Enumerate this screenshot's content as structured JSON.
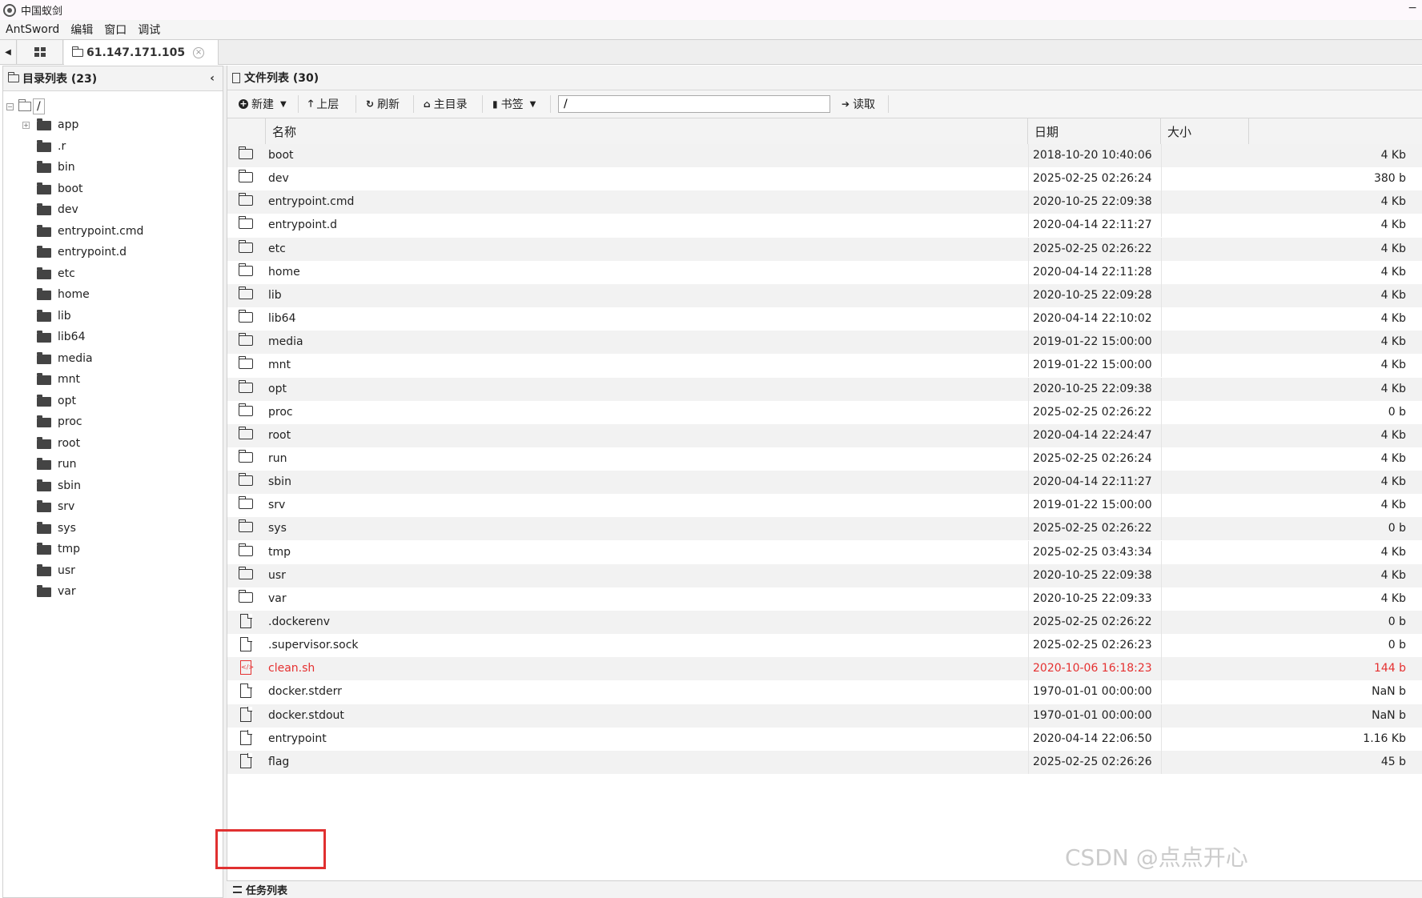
{
  "window": {
    "title": "中国蚁剑"
  },
  "menu": [
    "AntSword",
    "编辑",
    "窗口",
    "调试"
  ],
  "tabs": {
    "host": "61.147.171.105"
  },
  "left_panel": {
    "header": "目录列表 (23)",
    "root": "/",
    "items": [
      {
        "label": "app",
        "expandable": true
      },
      {
        "label": ".r"
      },
      {
        "label": "bin"
      },
      {
        "label": "boot"
      },
      {
        "label": "dev"
      },
      {
        "label": "entrypoint.cmd"
      },
      {
        "label": "entrypoint.d"
      },
      {
        "label": "etc"
      },
      {
        "label": "home"
      },
      {
        "label": "lib"
      },
      {
        "label": "lib64"
      },
      {
        "label": "media"
      },
      {
        "label": "mnt"
      },
      {
        "label": "opt"
      },
      {
        "label": "proc"
      },
      {
        "label": "root"
      },
      {
        "label": "run"
      },
      {
        "label": "sbin"
      },
      {
        "label": "srv"
      },
      {
        "label": "sys"
      },
      {
        "label": "tmp"
      },
      {
        "label": "usr"
      },
      {
        "label": "var"
      }
    ]
  },
  "right_panel": {
    "header": "文件列表 (30)",
    "toolbar": {
      "new_label": "新建",
      "up_label": "上层",
      "refresh_label": "刷新",
      "home_label": "主目录",
      "bookmark_label": "书签",
      "path_value": "/",
      "read_label": "读取"
    },
    "columns": {
      "name": "名称",
      "date": "日期",
      "size": "大小"
    },
    "files": [
      {
        "name": "boot",
        "date": "2018-10-20 10:40:06",
        "size": "4 Kb",
        "type": "folder"
      },
      {
        "name": "dev",
        "date": "2025-02-25 02:26:24",
        "size": "380 b",
        "type": "folder"
      },
      {
        "name": "entrypoint.cmd",
        "date": "2020-10-25 22:09:38",
        "size": "4 Kb",
        "type": "folder"
      },
      {
        "name": "entrypoint.d",
        "date": "2020-04-14 22:11:27",
        "size": "4 Kb",
        "type": "folder"
      },
      {
        "name": "etc",
        "date": "2025-02-25 02:26:22",
        "size": "4 Kb",
        "type": "folder"
      },
      {
        "name": "home",
        "date": "2020-04-14 22:11:28",
        "size": "4 Kb",
        "type": "folder"
      },
      {
        "name": "lib",
        "date": "2020-10-25 22:09:28",
        "size": "4 Kb",
        "type": "folder"
      },
      {
        "name": "lib64",
        "date": "2020-04-14 22:10:02",
        "size": "4 Kb",
        "type": "folder"
      },
      {
        "name": "media",
        "date": "2019-01-22 15:00:00",
        "size": "4 Kb",
        "type": "folder"
      },
      {
        "name": "mnt",
        "date": "2019-01-22 15:00:00",
        "size": "4 Kb",
        "type": "folder"
      },
      {
        "name": "opt",
        "date": "2020-10-25 22:09:38",
        "size": "4 Kb",
        "type": "folder"
      },
      {
        "name": "proc",
        "date": "2025-02-25 02:26:22",
        "size": "0 b",
        "type": "folder"
      },
      {
        "name": "root",
        "date": "2020-04-14 22:24:47",
        "size": "4 Kb",
        "type": "folder"
      },
      {
        "name": "run",
        "date": "2025-02-25 02:26:24",
        "size": "4 Kb",
        "type": "folder"
      },
      {
        "name": "sbin",
        "date": "2020-04-14 22:11:27",
        "size": "4 Kb",
        "type": "folder"
      },
      {
        "name": "srv",
        "date": "2019-01-22 15:00:00",
        "size": "4 Kb",
        "type": "folder"
      },
      {
        "name": "sys",
        "date": "2025-02-25 02:26:22",
        "size": "0 b",
        "type": "folder"
      },
      {
        "name": "tmp",
        "date": "2025-02-25 03:43:34",
        "size": "4 Kb",
        "type": "folder"
      },
      {
        "name": "usr",
        "date": "2020-10-25 22:09:38",
        "size": "4 Kb",
        "type": "folder"
      },
      {
        "name": "var",
        "date": "2020-10-25 22:09:33",
        "size": "4 Kb",
        "type": "folder"
      },
      {
        "name": ".dockerenv",
        "date": "2025-02-25 02:26:22",
        "size": "0 b",
        "type": "file"
      },
      {
        "name": ".supervisor.sock",
        "date": "2025-02-25 02:26:23",
        "size": "0 b",
        "type": "file"
      },
      {
        "name": "clean.sh",
        "date": "2020-10-06 16:18:23",
        "size": "144 b",
        "type": "script"
      },
      {
        "name": "docker.stderr",
        "date": "1970-01-01 00:00:00",
        "size": "NaN b",
        "type": "file"
      },
      {
        "name": "docker.stdout",
        "date": "1970-01-01 00:00:00",
        "size": "NaN b",
        "type": "file"
      },
      {
        "name": "entrypoint",
        "date": "2020-04-14 22:06:50",
        "size": "1.16 Kb",
        "type": "file"
      },
      {
        "name": "flag",
        "date": "2025-02-25 02:26:26",
        "size": "45 b",
        "type": "file"
      }
    ]
  },
  "task_bar": {
    "label": "任务列表"
  },
  "watermark": "CSDN @点点开心",
  "colors": {
    "script_file": "#e53030",
    "highlight": "#e03030"
  }
}
